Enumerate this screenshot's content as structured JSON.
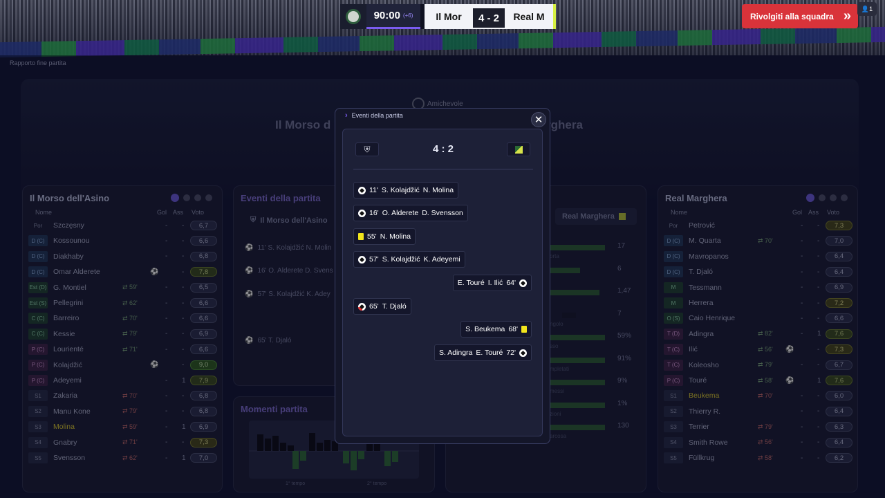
{
  "scorebar": {
    "time": "90:00",
    "added": "(+6)",
    "home": "Il Mor",
    "score": "4 - 2",
    "away": "Real M"
  },
  "return_button": "Rivolgiti alla squadra",
  "user_badge": "1",
  "breadcrumb": "Rapporto fine partita",
  "hero": {
    "competition": "Amichevole",
    "home_partial": "Il Morso d",
    "away_partial": "rghera"
  },
  "home_panel": {
    "title": "Il Morso dell'Asino",
    "headers": {
      "name": "Nome",
      "goals": "Gol",
      "assists": "Ass",
      "rating": "Voto"
    },
    "players": [
      {
        "pos": "Por",
        "name": "Szczęsny",
        "sub": "",
        "icon": "",
        "gol": "-",
        "ass": "-",
        "rating": "6,7"
      },
      {
        "pos": "D (C)",
        "name": "Kossounou",
        "sub": "",
        "icon": "",
        "gol": "-",
        "ass": "-",
        "rating": "6,6"
      },
      {
        "pos": "D (C)",
        "name": "Diakhaby",
        "sub": "",
        "icon": "",
        "gol": "-",
        "ass": "-",
        "rating": "6,8"
      },
      {
        "pos": "D (C)",
        "name": "Omar Alderete",
        "sub": "",
        "icon": "⚽",
        "gol": "",
        "ass": "-",
        "rating": "7,8"
      },
      {
        "pos": "Est (D)",
        "name": "G. Montiel",
        "sub": "59'",
        "icon": "",
        "gol": "-",
        "ass": "-",
        "rating": "6,5"
      },
      {
        "pos": "Est (S)",
        "name": "Pellegrini",
        "sub": "62'",
        "icon": "",
        "gol": "-",
        "ass": "-",
        "rating": "6,6"
      },
      {
        "pos": "C (C)",
        "name": "Barreiro",
        "sub": "70'",
        "icon": "",
        "gol": "-",
        "ass": "-",
        "rating": "6,6"
      },
      {
        "pos": "C (C)",
        "name": "Kessie",
        "sub": "79'",
        "icon": "",
        "gol": "-",
        "ass": "-",
        "rating": "6,9"
      },
      {
        "pos": "P (C)",
        "name": "Lourienté",
        "sub": "71'",
        "icon": "",
        "gol": "-",
        "ass": "-",
        "rating": "6,6"
      },
      {
        "pos": "P (C)",
        "name": "Kolajdžić",
        "sub": "",
        "icon": "⚽",
        "gol": "",
        "ass": "-",
        "rating": "9,0"
      },
      {
        "pos": "P (C)",
        "name": "Adeyemi",
        "sub": "",
        "icon": "",
        "gol": "-",
        "ass": "1",
        "rating": "7,9"
      },
      {
        "pos": "S1",
        "name": "Zakaria",
        "sub": "70'",
        "icon": "",
        "gol": "-",
        "ass": "-",
        "rating": "6,8"
      },
      {
        "pos": "S2",
        "name": "Manu Kone",
        "sub": "79'",
        "icon": "",
        "gol": "-",
        "ass": "-",
        "rating": "6,8"
      },
      {
        "pos": "S3",
        "name": "Molina",
        "sub": "59'",
        "icon": "",
        "gol": "-",
        "ass": "1",
        "rating": "6,9"
      },
      {
        "pos": "S4",
        "name": "Gnabry",
        "sub": "71'",
        "icon": "",
        "gol": "-",
        "ass": "-",
        "rating": "7,3"
      },
      {
        "pos": "S5",
        "name": "Svensson",
        "sub": "62'",
        "icon": "",
        "gol": "-",
        "ass": "1",
        "rating": "7,0"
      }
    ]
  },
  "away_panel": {
    "title": "Real Marghera",
    "headers": {
      "name": "Nome",
      "goals": "Gol",
      "assists": "Ass",
      "rating": "Voto"
    },
    "players": [
      {
        "pos": "Por",
        "name": "Petrović",
        "sub": "",
        "icon": "",
        "gol": "-",
        "ass": "-",
        "rating": "7,3"
      },
      {
        "pos": "D (C)",
        "name": "M. Quarta",
        "sub": "70'",
        "icon": "",
        "gol": "-",
        "ass": "-",
        "rating": "7,0"
      },
      {
        "pos": "D (C)",
        "name": "Mavropanos",
        "sub": "",
        "icon": "",
        "gol": "-",
        "ass": "-",
        "rating": "6,4"
      },
      {
        "pos": "D (C)",
        "name": "T. Djaló",
        "sub": "",
        "icon": "",
        "gol": "-",
        "ass": "-",
        "rating": "6,4"
      },
      {
        "pos": "M",
        "name": "Tessmann",
        "sub": "",
        "icon": "",
        "gol": "-",
        "ass": "-",
        "rating": "6,9"
      },
      {
        "pos": "M",
        "name": "Herrera",
        "sub": "",
        "icon": "",
        "gol": "-",
        "ass": "-",
        "rating": "7,2"
      },
      {
        "pos": "O (S)",
        "name": "Caio Henrique",
        "sub": "",
        "icon": "",
        "gol": "-",
        "ass": "-",
        "rating": "6,6"
      },
      {
        "pos": "T (D)",
        "name": "Adingra",
        "sub": "82'",
        "icon": "",
        "gol": "-",
        "ass": "1",
        "rating": "7,6"
      },
      {
        "pos": "T (C)",
        "name": "Ilić",
        "sub": "56'",
        "icon": "⚽",
        "gol": "",
        "ass": "-",
        "rating": "7,3"
      },
      {
        "pos": "T (C)",
        "name": "Koleosho",
        "sub": "79'",
        "icon": "",
        "gol": "-",
        "ass": "-",
        "rating": "6,7"
      },
      {
        "pos": "P (C)",
        "name": "Touré",
        "sub": "58'",
        "icon": "⚽",
        "gol": "",
        "ass": "1",
        "rating": "7,6"
      },
      {
        "pos": "S1",
        "name": "Beukema",
        "sub": "70'",
        "icon": "",
        "gol": "-",
        "ass": "-",
        "rating": "6,0"
      },
      {
        "pos": "S2",
        "name": "Thierry R.",
        "sub": "",
        "icon": "",
        "gol": "-",
        "ass": "-",
        "rating": "6,4"
      },
      {
        "pos": "S3",
        "name": "Terrier",
        "sub": "79'",
        "icon": "",
        "gol": "-",
        "ass": "-",
        "rating": "6,3"
      },
      {
        "pos": "S4",
        "name": "Smith Rowe",
        "sub": "56'",
        "icon": "",
        "gol": "-",
        "ass": "-",
        "rating": "6,4"
      },
      {
        "pos": "S5",
        "name": "Füllkrug",
        "sub": "58'",
        "icon": "",
        "gol": "-",
        "ass": "-",
        "rating": "6,2"
      }
    ]
  },
  "events_panel": {
    "title": "Eventi della partita",
    "home_team": "Il Morso dell'Asino",
    "rows": [
      "11' S. Kolajdžić N. Molin",
      "16' O. Alderete D. Svens",
      "57' S. Kolajdžić K. Adey",
      "65' T. Djaló"
    ]
  },
  "moments_panel": {
    "title": "Momenti partita",
    "half1": "1° tempo",
    "half2": "2° tempo"
  },
  "stats_panel": {
    "away_team": "Real Marghera",
    "values": [
      "17",
      "6",
      "1,47",
      "7",
      "59%",
      "91%",
      "9%",
      "1%",
      "130"
    ],
    "labels": [
      "orta",
      "",
      "",
      "ngolo",
      "sso",
      "mpletati",
      "messi",
      "zioni",
      "arcosa"
    ]
  },
  "modal": {
    "title": "Eventi della partita",
    "score": "4 : 2",
    "events": [
      {
        "side": "home",
        "type": "goal",
        "minute": "11'",
        "text": "S. Kolajdžić",
        "extra": "N. Molina"
      },
      {
        "side": "home",
        "type": "goal",
        "minute": "16'",
        "text": "O. Alderete",
        "extra": "D. Svensson"
      },
      {
        "side": "home",
        "type": "yellow",
        "minute": "55'",
        "text": "N. Molina",
        "extra": ""
      },
      {
        "side": "home",
        "type": "goal",
        "minute": "57'",
        "text": "S. Kolajdžić",
        "extra": "K. Adeyemi"
      },
      {
        "side": "away",
        "type": "goal",
        "minute": "64'",
        "text": "E. Touré",
        "extra": "I. Ilić"
      },
      {
        "side": "home",
        "type": "injury",
        "minute": "65'",
        "text": "T. Djaló",
        "extra": ""
      },
      {
        "side": "away",
        "type": "yellow",
        "minute": "68'",
        "text": "S. Beukema",
        "extra": ""
      },
      {
        "side": "away",
        "type": "goal",
        "minute": "72'",
        "text": "S. Adingra",
        "extra": "E. Touré"
      }
    ]
  }
}
